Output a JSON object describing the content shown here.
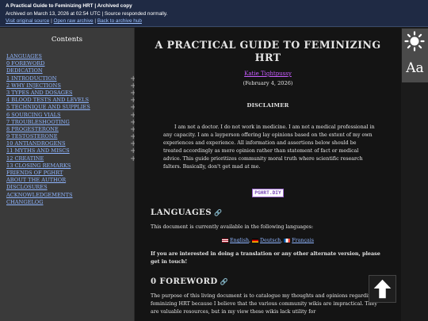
{
  "banner": {
    "title": "A Practical Guide to Feminizing HRT | Archived copy",
    "archived_line": "Archived on March 13, 2026 at 02:54 UTC | Source responded normally.",
    "links": [
      "Visit original source",
      "Open raw archive",
      "Back to archive hub"
    ],
    "separator": " | "
  },
  "toc": {
    "heading": "Contents",
    "items": [
      {
        "label": "LANGUAGES",
        "expandable": false
      },
      {
        "label": "0 FOREWORD",
        "expandable": false
      },
      {
        "label": "DEDICATION",
        "expandable": false
      },
      {
        "label": "1 INTRODUCTION",
        "expandable": true
      },
      {
        "label": "2 WHY INJECTIONS",
        "expandable": true
      },
      {
        "label": "3 TYPES AND DOSAGES",
        "expandable": true
      },
      {
        "label": "4 BLOOD TESTS AND LEVELS",
        "expandable": true
      },
      {
        "label": "5 TECHNIQUE AND SUPPLIES",
        "expandable": true
      },
      {
        "label": "6 SOURCING VIALS",
        "expandable": true
      },
      {
        "label": "7 TROUBLESHOOTING",
        "expandable": true
      },
      {
        "label": "8 PROGESTERONE",
        "expandable": true
      },
      {
        "label": "9 TESTOSTERONE",
        "expandable": true
      },
      {
        "label": "10 ANTIANDROGENS",
        "expandable": true
      },
      {
        "label": "11 MYTHS AND MISCS",
        "expandable": true
      },
      {
        "label": "12 CREATINE",
        "expandable": true
      },
      {
        "label": "13 CLOSING REMARKS",
        "expandable": false
      },
      {
        "label": "FRIENDS OF PGHRT",
        "expandable": false
      },
      {
        "label": "ABOUT THE AUTHOR",
        "expandable": false
      },
      {
        "label": "DISCLOSURES",
        "expandable": false
      },
      {
        "label": "ACKNOWLEDGEMENTS",
        "expandable": false
      },
      {
        "label": "CHANGELOG",
        "expandable": false
      }
    ],
    "expand_glyph": "+"
  },
  "main": {
    "title": "A PRACTICAL GUIDE TO FEMINIZING HRT",
    "author": "Katie Tightpussy",
    "date": "(February 4, 2026)",
    "disclaimer_heading": "DISCLAIMER",
    "disclaimer_text": "I am not a doctor. I do not work in medicine. I am not a medical professional in any capacity. I am a layperson offering lay opinions based on the extent of my own experiences and experience. All information and assertions below should be treated accordingly as mere opinion rather than statement of fact or medical advice. This guide prioritizes community moral truth where scientific research falters. Basically, don't get mad at me.",
    "badge": "PGHRT.DIY",
    "languages_heading": "LANGUAGES",
    "languages_intro": "This document is currently available in the following languages:",
    "languages": [
      "English",
      "Deutsch",
      "Français"
    ],
    "translate_note": "If you are interested in doing a translation or any other alternate version, please get in touch!",
    "foreword_heading": "0 FOREWORD",
    "foreword_text": "The purpose of this living document is to catalogue my thoughts and opinions regarding feminizing HRT because I believe that the various community wikis are impractical. They are valuable resources, but in my view these wikis lack utility for",
    "anchor_icon": "link-icon"
  },
  "controls": {
    "theme_icon": "sun-icon",
    "font_button": "Aa",
    "top_icon": "arrow-up-icon"
  },
  "colors": {
    "banner_bg": "#1f2a44",
    "toc_bg": "#3a3a3a",
    "main_bg": "#141414",
    "link": "#8fb5ff",
    "author_link": "#c75dff"
  }
}
